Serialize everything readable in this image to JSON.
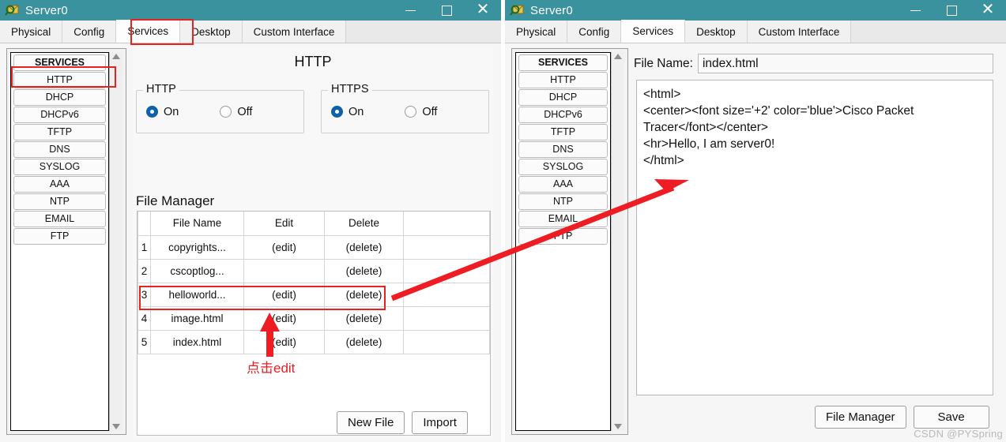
{
  "colors": {
    "titlebar": "#3a929f",
    "annotation_red": "#ee1c23",
    "highlight_red": "#e8231f",
    "radio_on": "#0c62ad"
  },
  "windows": [
    {
      "id": "left",
      "title": "Server0",
      "icon": "packet-tracer-icon",
      "titlebar_buttons": [
        {
          "name": "minimize",
          "glyph": ""
        },
        {
          "name": "maximize",
          "glyph": ""
        },
        {
          "name": "close",
          "glyph": "✕"
        }
      ],
      "tabs": [
        {
          "label": "Physical",
          "active": false
        },
        {
          "label": "Config",
          "active": false
        },
        {
          "label": "Services",
          "active": true
        },
        {
          "label": "Desktop",
          "active": false
        },
        {
          "label": "Custom Interface",
          "active": false
        }
      ],
      "sidebar": {
        "header": "SERVICES",
        "items": [
          {
            "label": "HTTP",
            "selected": true
          },
          {
            "label": "DHCP",
            "selected": false
          },
          {
            "label": "DHCPv6",
            "selected": false
          },
          {
            "label": "TFTP",
            "selected": false
          },
          {
            "label": "DNS",
            "selected": false
          },
          {
            "label": "SYSLOG",
            "selected": false
          },
          {
            "label": "AAA",
            "selected": false
          },
          {
            "label": "NTP",
            "selected": false
          },
          {
            "label": "EMAIL",
            "selected": false
          },
          {
            "label": "FTP",
            "selected": false
          }
        ]
      },
      "page_title": "HTTP",
      "http_group": {
        "legend": "HTTP",
        "options": [
          {
            "label": "On",
            "selected": true
          },
          {
            "label": "Off",
            "selected": false
          }
        ]
      },
      "https_group": {
        "legend": "HTTPS",
        "options": [
          {
            "label": "On",
            "selected": true
          },
          {
            "label": "Off",
            "selected": false
          }
        ]
      },
      "file_manager": {
        "title": "File Manager",
        "columns": [
          "",
          "File Name",
          "Edit",
          "Delete"
        ],
        "rows": [
          {
            "index": "1",
            "file_name": "copyrights...",
            "edit": "(edit)",
            "delete": "(delete)",
            "highlighted": false
          },
          {
            "index": "2",
            "file_name": "cscoptlog...",
            "edit": "",
            "delete": "(delete)",
            "highlighted": false
          },
          {
            "index": "3",
            "file_name": "helloworld...",
            "edit": "(edit)",
            "delete": "(delete)",
            "highlighted": false
          },
          {
            "index": "4",
            "file_name": "image.html",
            "edit": "(edit)",
            "delete": "(delete)",
            "highlighted": false
          },
          {
            "index": "5",
            "file_name": "index.html",
            "edit": "(edit)",
            "delete": "(delete)",
            "highlighted": true
          }
        ]
      },
      "buttons": [
        {
          "label": "New File",
          "name": "new-file-button"
        },
        {
          "label": "Import",
          "name": "import-button"
        }
      ]
    },
    {
      "id": "right",
      "title": "Server0",
      "icon": "packet-tracer-icon",
      "titlebar_buttons": [
        {
          "name": "minimize",
          "glyph": ""
        },
        {
          "name": "maximize",
          "glyph": ""
        },
        {
          "name": "close",
          "glyph": "✕"
        }
      ],
      "tabs": [
        {
          "label": "Physical",
          "active": false
        },
        {
          "label": "Config",
          "active": false
        },
        {
          "label": "Services",
          "active": true
        },
        {
          "label": "Desktop",
          "active": false
        },
        {
          "label": "Custom Interface",
          "active": false
        }
      ],
      "sidebar": {
        "header": "SERVICES",
        "items": [
          {
            "label": "HTTP",
            "selected": false
          },
          {
            "label": "DHCP",
            "selected": false
          },
          {
            "label": "DHCPv6",
            "selected": false
          },
          {
            "label": "TFTP",
            "selected": false
          },
          {
            "label": "DNS",
            "selected": false
          },
          {
            "label": "SYSLOG",
            "selected": false
          },
          {
            "label": "AAA",
            "selected": false
          },
          {
            "label": "NTP",
            "selected": false
          },
          {
            "label": "EMAIL",
            "selected": false
          },
          {
            "label": "FTP",
            "selected": false
          }
        ]
      },
      "file_name": {
        "label": "File Name:",
        "value": "index.html",
        "placeholder": ""
      },
      "editor": {
        "content": "<html>\n<center><font size='+2' color='blue'>Cisco Packet Tracer</font></center>\n<hr>Hello, I am server0!\n</html>"
      },
      "buttons": [
        {
          "label": "File Manager",
          "name": "file-manager-button"
        },
        {
          "label": "Save",
          "name": "save-button"
        }
      ]
    }
  ],
  "annotations": {
    "click_edit_text": "点击edit"
  },
  "watermark": "CSDN @PYSpring"
}
